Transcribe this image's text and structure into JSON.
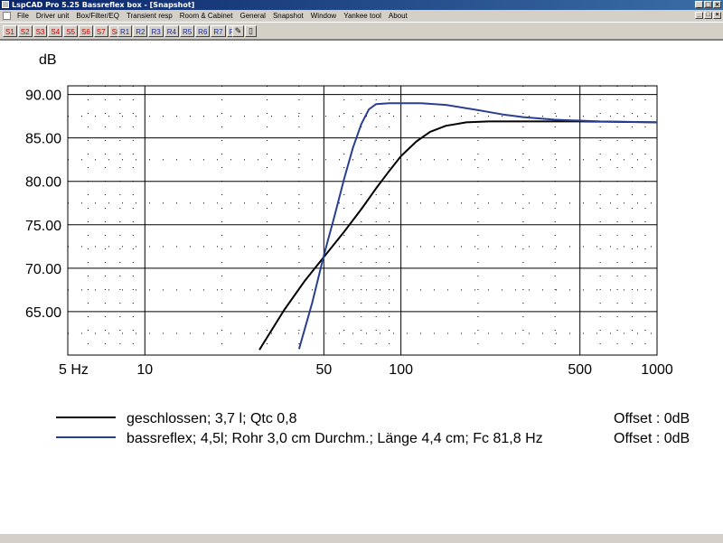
{
  "window": {
    "title": "LspCAD Pro 5.25 Bassreflex box - [Snapshot]"
  },
  "menu": [
    "File",
    "Driver unit",
    "Box/Filter/EQ",
    "Transient resp",
    "Room & Cabinet",
    "General",
    "Snapshot",
    "Window",
    "Yankee tool",
    "About"
  ],
  "toolbar": {
    "s_buttons": [
      "S1",
      "S2",
      "S3",
      "S4",
      "S5",
      "S6",
      "S7",
      "S8"
    ],
    "r_buttons": [
      "R1",
      "R2",
      "R3",
      "R4",
      "R5",
      "R6",
      "R7",
      "R8"
    ]
  },
  "chart_data": {
    "type": "line",
    "ylabel": "dB",
    "xscale": "log",
    "xlim": [
      5,
      1000
    ],
    "ylim": [
      60,
      91
    ],
    "x_ticks": [
      "5 Hz",
      "10",
      "50",
      "100",
      "500",
      "1000"
    ],
    "y_ticks": [
      "90.00",
      "85.00",
      "80.00",
      "75.00",
      "70.00",
      "65.00"
    ],
    "grid": true,
    "series": [
      {
        "name": "geschlossen; 3,7 l; Qtc 0,8",
        "offset": "Offset : 0dB",
        "color": "#000000",
        "points": [
          [
            28,
            60.6
          ],
          [
            35,
            65.2
          ],
          [
            42,
            68.5
          ],
          [
            50,
            71.3
          ],
          [
            60,
            74.2
          ],
          [
            70,
            76.8
          ],
          [
            80,
            79.2
          ],
          [
            90,
            81.2
          ],
          [
            100,
            82.9
          ],
          [
            115,
            84.6
          ],
          [
            130,
            85.7
          ],
          [
            150,
            86.4
          ],
          [
            180,
            86.8
          ],
          [
            220,
            86.9
          ],
          [
            300,
            86.9
          ],
          [
            500,
            86.9
          ],
          [
            1000,
            86.8
          ]
        ]
      },
      {
        "name": "bassreflex; 4,5l; Rohr 3,0 cm Durchm.; Länge 4,4 cm; Fc 81,8 Hz",
        "offset": "Offset : 0dB",
        "color": "#2a3f8f",
        "points": [
          [
            40,
            60.7
          ],
          [
            45,
            66.0
          ],
          [
            50,
            71.5
          ],
          [
            55,
            76.0
          ],
          [
            60,
            80.3
          ],
          [
            65,
            83.9
          ],
          [
            70,
            86.6
          ],
          [
            75,
            88.3
          ],
          [
            80,
            88.9
          ],
          [
            90,
            89.0
          ],
          [
            100,
            89.0
          ],
          [
            120,
            89.0
          ],
          [
            150,
            88.8
          ],
          [
            200,
            88.2
          ],
          [
            250,
            87.7
          ],
          [
            300,
            87.4
          ],
          [
            400,
            87.1
          ],
          [
            600,
            86.9
          ],
          [
            1000,
            86.8
          ]
        ]
      }
    ]
  }
}
